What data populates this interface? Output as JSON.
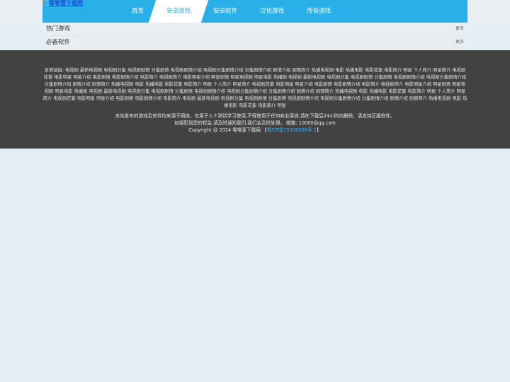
{
  "logo": {
    "alt_text": "零零壹下载网"
  },
  "nav": {
    "items": [
      {
        "label": "首页"
      },
      {
        "label": "安卓游戏"
      },
      {
        "label": "安卓软件"
      },
      {
        "label": "汉化游戏"
      },
      {
        "label": "传奇游戏"
      }
    ],
    "active_index": 1
  },
  "sections": [
    {
      "title": "热门游戏",
      "more": "更多"
    },
    {
      "title": "必备软件",
      "more": "更多"
    }
  ],
  "footer": {
    "links_label": "友情链接:",
    "links": [
      "电视剧",
      "最新电视剧",
      "电视剧分集",
      "电视剧剧情",
      "分集剧情",
      "电视剧剧情介绍",
      "电视剧分集剧情介绍",
      "分集剧情介绍",
      "剧情介绍",
      "剧情简介",
      "热播电视剧",
      "电影",
      "热播电影",
      "电影花絮",
      "电影简介",
      "明星",
      "个人简介",
      "明星简介",
      "电视剧花絮",
      "电影明星",
      "明星介绍",
      "电影剧情",
      "电影剧情介绍",
      "电影简介",
      "电视剧简介",
      "电影明星介绍",
      "明星剧情",
      "明星电视剧",
      "明星电影",
      "热播剧",
      "电视剧",
      "最新电视剧",
      "电视剧分集",
      "电视剧剧情",
      "分集剧情",
      "电视剧剧情介绍",
      "电视剧分集剧情介绍",
      "分集剧情介绍",
      "剧情介绍",
      "剧情简介",
      "热播电视剧",
      "电影",
      "热播电影",
      "电影花絮",
      "电影简介",
      "明星",
      "个人简介",
      "明星简介",
      "电视剧花絮",
      "电影明星",
      "明星介绍",
      "电影剧情",
      "电影剧情介绍",
      "电影简介",
      "电视剧简介",
      "电影明星介绍",
      "明星剧情",
      "明星电视剧",
      "明星电影",
      "热播剧",
      "电视剧",
      "最新电视剧",
      "电视剧分集",
      "电视剧剧情",
      "分集剧情",
      "电视剧剧情介绍",
      "电视剧分集剧情介绍",
      "分集剧情介绍",
      "剧情介绍",
      "剧情简介",
      "热播电视剧",
      "电影",
      "热播电影",
      "电影花絮",
      "电影简介",
      "明星",
      "个人简介",
      "明星简介",
      "电视剧花絮",
      "电影明星",
      "明星介绍",
      "电影剧情",
      "电影剧情介绍",
      "电影简介",
      "电视剧",
      "最新电视剧",
      "电视剧分集",
      "电视剧剧情",
      "分集剧情",
      "电视剧剧情介绍",
      "电视剧分集剧情介绍",
      "分集剧情介绍",
      "剧情介绍",
      "剧情简介",
      "热播电视剧",
      "电影",
      "热播电影",
      "电影花絮",
      "电影简介",
      "明星"
    ],
    "disclaimer": "本站发布的游戏及软件均来源于网络，仅用于人个测试学习使用,不得使用于任何商业用途,请在下载后24小时内删除，请支持正版软件。",
    "contact": "如侵犯到您的权益,请及时通知我们,我们会及时处理。 邮箱: 10000@qq.com",
    "copyright": "Copyright @ 2024 零零壹下载网",
    "icp_open": "【",
    "icp": "粤ICP备15000000号-1",
    "icp_close": "】"
  }
}
